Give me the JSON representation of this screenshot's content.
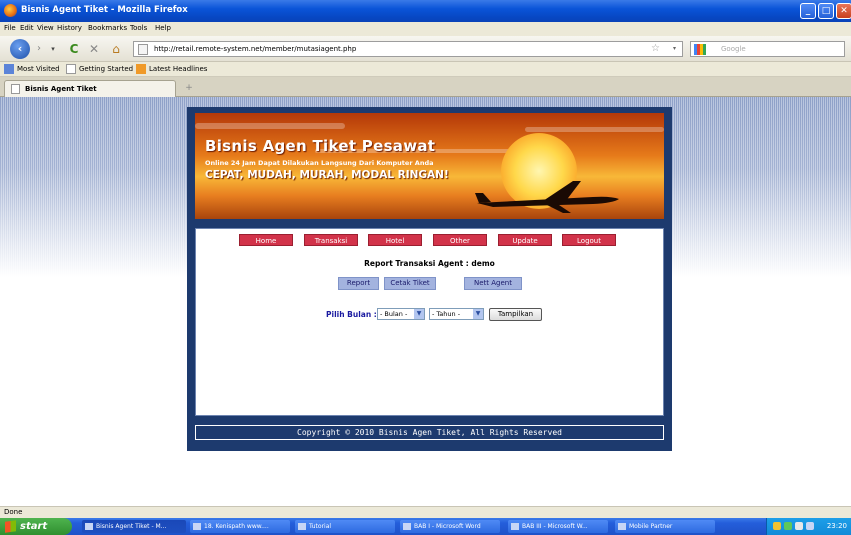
{
  "window": {
    "title": "Bisnis Agent Tiket - Mozilla Firefox"
  },
  "menu_bar": [
    "File",
    "Edit",
    "View",
    "History",
    "Bookmarks",
    "Tools",
    "Help"
  ],
  "nav": {
    "url": "http://retail.remote-system.net/member/mutasiagent.php",
    "search_placeholder": "Google"
  },
  "bookmarks": [
    "Most Visited",
    "Getting Started",
    "Latest Headlines"
  ],
  "tabs": [
    {
      "label": "Bisnis Agent Tiket"
    }
  ],
  "new_tab_symbol": "+",
  "banner": {
    "title": "Bisnis Agen Tiket Pesawat",
    "subtitle": "Online 24 Jam Dapat Dilakukan Langsung Dari Komputer Anda",
    "tagline": "CEPAT, MUDAH, MURAH, MODAL RINGAN!"
  },
  "site_menu": [
    "Home",
    "Transaksi",
    "Hotel",
    "Other",
    "Update",
    "Logout"
  ],
  "report": {
    "title": "Report Transaksi Agent : demo",
    "sub_buttons": [
      "Report",
      "Cetak Tiket",
      "Nett Agent"
    ],
    "filter_label": "Pilih Bulan :",
    "month_select": "- Bulan -",
    "year_select": "- Tahun -",
    "submit_label": "Tampilkan"
  },
  "footer": "Copyright © 2010 Bisnis Agen Tiket, All Rights Reserved",
  "status": "Done",
  "taskbar": {
    "start_label": "start",
    "tasks": [
      "Bisnis Agent Tiket - M...",
      "18. Kenispath www....",
      "Tutorial",
      "BAB I - Microsoft Word",
      "BAB III - Microsoft W...",
      "Mobile Partner"
    ],
    "clock": "23:20"
  },
  "colors": {
    "menu_button": "#d2334a",
    "sub_button": "#a3b3df",
    "page_frame": "#1d3a6e",
    "filter_label": "#1a1aa0"
  }
}
